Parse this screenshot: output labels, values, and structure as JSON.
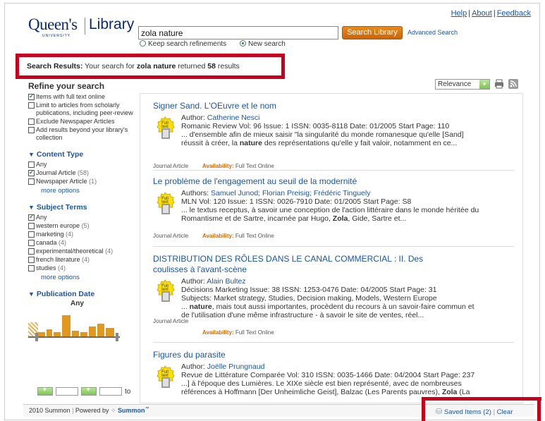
{
  "header": {
    "logo_queens": "Queen's",
    "logo_library": "Library",
    "logo_university": "UNIVERSITY",
    "links": [
      "Help",
      "About",
      "Feedback"
    ],
    "link_sep": "|"
  },
  "search": {
    "query": "zola nature",
    "button_label": "Search Library",
    "advanced_label": "Advanced Search",
    "option_keep": "Keep search refinements",
    "option_new": "New search",
    "selected_option": "New search"
  },
  "results_summary": {
    "label": "Search Results:",
    "text_before": "Your search for",
    "query": "zola nature",
    "text_mid": "returned",
    "count": "58",
    "text_after": "results"
  },
  "sidebar": {
    "title": "Refine your search",
    "refine_options": [
      {
        "label": "Items with full text online",
        "checked": true
      },
      {
        "label": "Limit to articles from scholarly publications, including peer-review",
        "checked": false
      },
      {
        "label": "Exclude Newspaper Articles",
        "checked": false
      },
      {
        "label": "Add results beyond your library's collection",
        "checked": false
      }
    ],
    "content_type": {
      "heading": "Content Type",
      "items": [
        {
          "label": "Any",
          "count": "",
          "checked": false
        },
        {
          "label": "Journal Article",
          "count": "(58)",
          "checked": true
        },
        {
          "label": "Newspaper Article",
          "count": "(1)",
          "checked": false
        }
      ],
      "more": "more options"
    },
    "subject_terms": {
      "heading": "Subject Terms",
      "items": [
        {
          "label": "Any",
          "count": "",
          "checked": true
        },
        {
          "label": "western europe",
          "count": "(5)",
          "checked": false
        },
        {
          "label": "marketing",
          "count": "(4)",
          "checked": false
        },
        {
          "label": "canada",
          "count": "(4)",
          "checked": false
        },
        {
          "label": "experimental/theoretical",
          "count": "(4)",
          "checked": false
        },
        {
          "label": "french literature",
          "count": "(4)",
          "checked": false
        },
        {
          "label": "studies",
          "count": "(4)",
          "checked": false
        }
      ],
      "more": "more options"
    },
    "publication_date": {
      "heading": "Publication Date",
      "selection": "Any",
      "to_label": "to"
    }
  },
  "toolbar": {
    "sort_value": "Relevance",
    "print_icon": "print-icon",
    "rss_icon": "rss-icon"
  },
  "results": [
    {
      "title": "Signer Sand. L'OEuvre et le nom",
      "author_label": "Author:",
      "authors": "Catherine Nesci",
      "line2": "Romanic Review Vol: 96 Issue: 1 ISSN: 0035-8118 Date: 01/2005 Start Page: 110",
      "line3": "... d'ensemble afin de mieux saisir \"la singularité du monde romanesque qu'elle [Sand]",
      "line4_a": "réussit à créer, la ",
      "line4_b": "nature",
      "line4_c": " des représentations qu'elle y fait valoir, notamment en ce...",
      "type": "Journal Article",
      "availability_label": "Availability:",
      "availability": "Full Text Online"
    },
    {
      "title": "Le problème de l'engagement au seuil de la modernité",
      "author_label": "Authors:",
      "authors": "Samuel Junod; Florian Preisig; Frédéric Tinguely",
      "line2": "MLN Vol: 120 Issue: 1 ISSN: 0026-7910 Date: 01/2005 Start Page: S8",
      "line3": "... le textus receptus, à savoir une conception de l'action littéraire dans le monde héritée du",
      "line4_a": "Romantisme et de Sartre, incarnée par Hugo, ",
      "line4_b": "Zola",
      "line4_c": ", Gide, Sartre et...",
      "type": "Journal Article",
      "availability_label": "Availability:",
      "availability": "Full Text Online"
    },
    {
      "title": "DISTRIBUTION DES RÔLES DANS LE CANAL COMMERCIAL : II. Des coulisses à l'avant-scène",
      "author_label": "Author:",
      "authors": "Alain Bultez",
      "line2": "Décisions Marketing Issue: 38 ISSN: 1253-0476 Date: 04/2005 Start Page: 31",
      "line3": "Subjects: Market strategy, Studies, Decision making, Models, Western Europe",
      "line4_a": "... ",
      "line4_b": "nature",
      "line4_c": ", mais tout aussi importantes, procèdent du recours à un savoir-faire commun et",
      "line5": "de l'utilisation d'une même infrastructure - à savoir le site de ventes, réel...",
      "type": "Journal Article",
      "availability_label": "Availability:",
      "availability": "Full Text Online"
    },
    {
      "title": "Figures du parasite",
      "author_label": "Author:",
      "authors": "Joëlle Prungnaud",
      "line2": "Revue de Littérature Comparée Vol: 310 ISSN: 0035-1466 Date: 04/2004 Start Page: 237",
      "line3": "...] à l'époque des Lumières. Le XIXe siècle est bien représenté, avec de nombreuses",
      "line4_a": "références à Hoffmann [Der Unheimliche Geist], Balzac (Les Parents pauvres), ",
      "line4_b": "Zola",
      "line4_c": " (La"
    }
  ],
  "badge_text": [
    "Full",
    "text"
  ],
  "footer": {
    "left": "2010 Summon",
    "powered": "Powered by",
    "brand": "Summon",
    "saved_items": "Saved Items (2)",
    "clear": "Clear"
  },
  "colors": {
    "link": "#1a55a8",
    "accent_orange": "#d46a00",
    "highlight_red": "#c8001e",
    "facet_bar": "#e0981f"
  }
}
